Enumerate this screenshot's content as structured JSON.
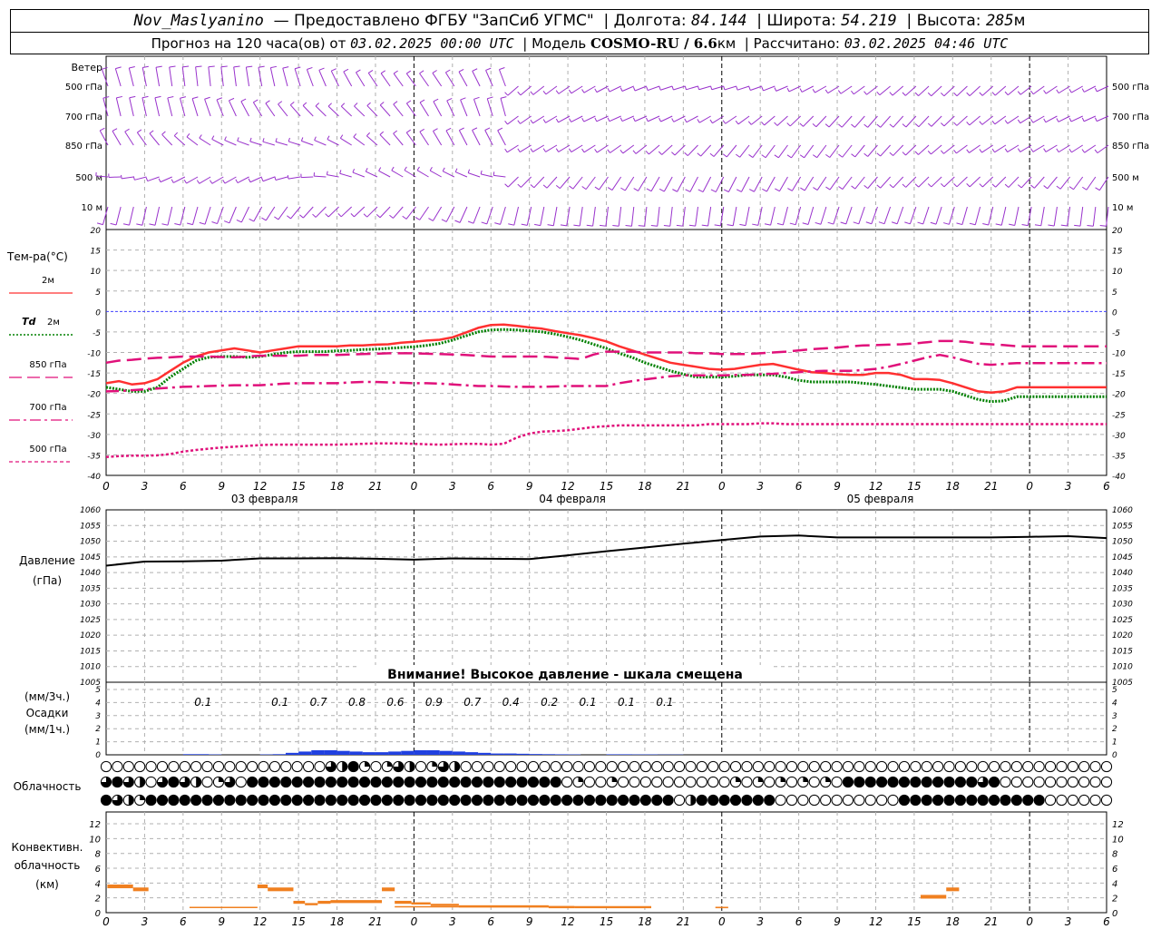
{
  "header": {
    "station": "Nov_Maslyanino",
    "provider": "Предоставлено ФГБУ \"ЗапСиб УГМС\"",
    "lon_label": "Долгота:",
    "lon": "84.144",
    "lat_label": "Широта:",
    "lat": "54.219",
    "alt_label": "Высота:",
    "alt": "285",
    "alt_unit": "м",
    "forecast_label": "Прогноз на 120 часа(ов) от",
    "forecast_start": "03.02.2025 00:00 UTC",
    "model_label": "Модель",
    "model": "COSMO-RU / 6.6",
    "model_unit": "км",
    "computed_label": "Рассчитано:",
    "computed": "03.02.2025 04:46 UTC"
  },
  "hour_ticks": [
    "0",
    "3",
    "6",
    "9",
    "12",
    "15",
    "18",
    "21",
    "0",
    "3",
    "6",
    "9",
    "12",
    "15",
    "18",
    "21",
    "0",
    "3",
    "6",
    "9",
    "12",
    "15",
    "18",
    "21",
    "0",
    "3",
    "6"
  ],
  "dates": [
    "03 февраля",
    "04 февраля",
    "05 февраля"
  ],
  "wind": {
    "title": "Ветер",
    "levels": [
      "500 гПа",
      "700 гПа",
      "850 гПа",
      "500 м",
      "10 м"
    ],
    "color": "#9932cc"
  },
  "temp": {
    "title": "Тем-ра(°C)",
    "ylim": [
      -40,
      20
    ],
    "ticks": [
      "20",
      "15",
      "10",
      "5",
      "0",
      "-5",
      "-10",
      "-15",
      "-20",
      "-25",
      "-30",
      "-35",
      "-40"
    ],
    "legend": [
      {
        "label": "2м",
        "color": "#ff3030",
        "dash": "solid"
      },
      {
        "label_pre": "Td",
        "label": "2м",
        "color": "#008000",
        "dash": "dotted"
      },
      {
        "label": "850 гПа",
        "color": "#e0107a",
        "dash": "long"
      },
      {
        "label": "700 гПа",
        "color": "#e0107a",
        "dash": "dashdot"
      },
      {
        "label": "500 гПа",
        "color": "#e0107a",
        "dash": "short"
      }
    ]
  },
  "pressure": {
    "title": "Давление",
    "unit": "(гПа)",
    "ylim": [
      1005,
      1060
    ],
    "ticks": [
      "1060",
      "1055",
      "1050",
      "1045",
      "1040",
      "1035",
      "1030",
      "1025",
      "1020",
      "1015",
      "1010",
      "1005"
    ],
    "warning": "Внимание! Высокое давление - шкала смещена"
  },
  "precip": {
    "unit3": "(мм/3ч.)",
    "title": "Осадки",
    "unit1": "(мм/1ч.)",
    "ticks": [
      "5",
      "4",
      "3",
      "2",
      "1",
      "0"
    ],
    "labels3h": [
      {
        "h": 6,
        "v": "0.1"
      },
      {
        "h": 12,
        "v": "0.1"
      },
      {
        "h": 15,
        "v": "0.7"
      },
      {
        "h": 18,
        "v": "0.8"
      },
      {
        "h": 21,
        "v": "0.6"
      },
      {
        "h": 24,
        "v": "0.9"
      },
      {
        "h": 27,
        "v": "0.7"
      },
      {
        "h": 30,
        "v": "0.4"
      },
      {
        "h": 33,
        "v": "0.2"
      },
      {
        "h": 36,
        "v": "0.1"
      },
      {
        "h": 39,
        "v": "0.1"
      },
      {
        "h": 42,
        "v": "0.1"
      }
    ]
  },
  "cloud": {
    "title": "Облачность"
  },
  "conv": {
    "title1": "Конвективн.",
    "title2": "облачность",
    "unit": "(км)",
    "ticks": [
      "12",
      "10",
      "8",
      "6",
      "4",
      "2",
      "0"
    ]
  },
  "colors": {
    "t2m": "#ff3030",
    "td": "#008000",
    "upper": "#e0107a",
    "zero": "#4040ff",
    "pressure": "#000000",
    "precip": "#2040e0",
    "conv": "#f08020",
    "grid": "#b0b0b0"
  },
  "chart_data": [
    {
      "type": "line",
      "title": "Тем-ра(°C)",
      "ylim": [
        -40,
        20
      ],
      "x": [
        0,
        1,
        2,
        3,
        4,
        5,
        6,
        7,
        8,
        9,
        10,
        11,
        12,
        13,
        14,
        15,
        16,
        17,
        18,
        19,
        20,
        21,
        22,
        23,
        24,
        25,
        26,
        27,
        28,
        29,
        30,
        31,
        32,
        33,
        34,
        35,
        36,
        37,
        38,
        39,
        40,
        41,
        42,
        43,
        44,
        45,
        46,
        47,
        48,
        49,
        50,
        51,
        52,
        53,
        54,
        55,
        56,
        57,
        58,
        59,
        60,
        61,
        62,
        63,
        64,
        65,
        66,
        67,
        68,
        69,
        70,
        71,
        72,
        73,
        74,
        75,
        76,
        77,
        78
      ],
      "series": [
        {
          "name": "2м",
          "values": [
            -17.5,
            -17,
            -17.8,
            -17.5,
            -16.5,
            -14.5,
            -12.5,
            -11,
            -10,
            -9.5,
            -9,
            -9.5,
            -10,
            -9.5,
            -9,
            -8.5,
            -8.5,
            -8.5,
            -8.5,
            -8.3,
            -8.3,
            -8.1,
            -8,
            -7.6,
            -7.4,
            -7.1,
            -6.9,
            -6.3,
            -5.2,
            -4,
            -3.3,
            -3.2,
            -3.5,
            -3.9,
            -4.2,
            -4.8,
            -5.3,
            -5.8,
            -6.5,
            -7.3,
            -8.5,
            -9.5,
            -10.5,
            -11.5,
            -12.5,
            -13,
            -13.5,
            -14,
            -14.2,
            -14,
            -13.5,
            -13,
            -12.8,
            -13.5,
            -14.2,
            -14.8,
            -15,
            -15.3,
            -15.5,
            -15.5,
            -15,
            -15,
            -15.5,
            -16.5,
            -16.5,
            -16.7,
            -17.5,
            -18.5,
            -19.5,
            -19.8,
            -19.5,
            -18.5,
            -18.5,
            -18.5,
            -18.5,
            -18.5,
            -18.5,
            -18.5,
            -18.5
          ]
        },
        {
          "name": "Td 2м",
          "values": [
            -18.5,
            -19,
            -19.5,
            -19.5,
            -18.5,
            -16,
            -14,
            -12,
            -11.2,
            -11,
            -11,
            -11.2,
            -11,
            -10.5,
            -10,
            -9.8,
            -9.8,
            -9.8,
            -9.6,
            -9.5,
            -9.3,
            -9.2,
            -9,
            -8.8,
            -8.6,
            -8.3,
            -7.8,
            -7,
            -6,
            -5,
            -4.5,
            -4.4,
            -4.5,
            -4.7,
            -5,
            -5.5,
            -6.2,
            -7,
            -8,
            -9,
            -10.2,
            -11.2,
            -12.5,
            -13.5,
            -14.5,
            -15.3,
            -16,
            -16,
            -16,
            -15.8,
            -15.5,
            -15.5,
            -15.5,
            -16,
            -16.8,
            -17.2,
            -17.2,
            -17.2,
            -17.2,
            -17.5,
            -17.8,
            -18.2,
            -18.6,
            -19,
            -19,
            -19,
            -19.5,
            -20.5,
            -21.5,
            -22,
            -21.8,
            -20.8,
            -20.8,
            -20.8,
            -20.8,
            -20.8,
            -20.8,
            -20.8,
            -20.8
          ]
        },
        {
          "name": "850 гПа",
          "values": [
            -12.5,
            -12,
            -11.8,
            -11.5,
            -11.3,
            -11.2,
            -11,
            -11,
            -11,
            -11.1,
            -11.2,
            -11,
            -10.8,
            -10.8,
            -10.8,
            -10.8,
            -10.6,
            -10.6,
            -10.6,
            -10.5,
            -10.4,
            -10.3,
            -10.2,
            -10.2,
            -10.2,
            -10.3,
            -10.4,
            -10.5,
            -10.6,
            -10.8,
            -11,
            -11,
            -11,
            -11,
            -11,
            -11.2,
            -11.4,
            -11.6,
            -10.5,
            -9.8,
            -9.8,
            -9.8,
            -10,
            -10,
            -10,
            -10,
            -10.2,
            -10.2,
            -10.4,
            -10.4,
            -10.4,
            -10.2,
            -10,
            -9.8,
            -9.5,
            -9.2,
            -9,
            -8.8,
            -8.5,
            -8.3,
            -8.2,
            -8.1,
            -8,
            -7.8,
            -7.5,
            -7.2,
            -7.2,
            -7.4,
            -7.8,
            -8,
            -8.2,
            -8.5,
            -8.5,
            -8.5,
            -8.5,
            -8.5,
            -8.5,
            -8.5,
            -8.5
          ]
        },
        {
          "name": "700 гПа",
          "values": [
            -19.5,
            -19.4,
            -19.2,
            -19,
            -18.8,
            -18.6,
            -18.4,
            -18.3,
            -18.2,
            -18.1,
            -18,
            -18,
            -18,
            -17.8,
            -17.6,
            -17.5,
            -17.5,
            -17.5,
            -17.5,
            -17.3,
            -17.2,
            -17.2,
            -17.3,
            -17.4,
            -17.5,
            -17.5,
            -17.6,
            -17.8,
            -18,
            -18.2,
            -18.2,
            -18.3,
            -18.4,
            -18.4,
            -18.4,
            -18.3,
            -18.2,
            -18.2,
            -18.2,
            -18.2,
            -17.5,
            -17,
            -16.6,
            -16.2,
            -15.8,
            -15.6,
            -15.6,
            -15.6,
            -15.6,
            -15.5,
            -15.5,
            -15.3,
            -15.2,
            -15,
            -14.8,
            -14.6,
            -14.5,
            -14.5,
            -14.5,
            -14.3,
            -14,
            -13.5,
            -12.8,
            -12,
            -11.2,
            -10.6,
            -11.2,
            -12,
            -12.8,
            -13,
            -12.8,
            -12.6,
            -12.6,
            -12.6,
            -12.6,
            -12.6,
            -12.6,
            -12.6,
            -12.6
          ]
        },
        {
          "name": "500 гПа",
          "values": [
            -35.5,
            -35.3,
            -35.2,
            -35.2,
            -35.1,
            -34.8,
            -34.2,
            -33.8,
            -33.5,
            -33.2,
            -33,
            -32.8,
            -32.6,
            -32.5,
            -32.5,
            -32.5,
            -32.5,
            -32.5,
            -32.5,
            -32.4,
            -32.3,
            -32.2,
            -32.2,
            -32.2,
            -32.3,
            -32.4,
            -32.5,
            -32.4,
            -32.3,
            -32.3,
            -32.5,
            -32.3,
            -30.8,
            -29.8,
            -29.3,
            -29.2,
            -29,
            -28.6,
            -28.2,
            -28,
            -27.8,
            -27.8,
            -27.8,
            -27.8,
            -27.8,
            -27.8,
            -27.8,
            -27.5,
            -27.5,
            -27.5,
            -27.5,
            -27.3,
            -27.3,
            -27.5,
            -27.5,
            -27.5,
            -27.5,
            -27.5,
            -27.5,
            -27.5,
            -27.5,
            -27.5,
            -27.5,
            -27.5,
            -27.5,
            -27.5,
            -27.5,
            -27.5,
            -27.5,
            -27.5,
            -27.5,
            -27.5,
            -27.5,
            -27.5,
            -27.5,
            -27.5,
            -27.5,
            -27.5,
            -27.5
          ]
        }
      ]
    },
    {
      "type": "line",
      "title": "Давление",
      "ylim": [
        1005,
        1060
      ],
      "x": [
        0,
        3,
        6,
        9,
        12,
        15,
        18,
        21,
        24,
        27,
        30,
        33,
        36,
        39,
        42,
        45,
        48,
        51,
        54,
        57,
        60,
        63,
        66,
        69,
        72,
        75,
        78
      ],
      "series": [
        {
          "name": "Давление",
          "values": [
            1042.2,
            1043.5,
            1043.6,
            1043.8,
            1044.5,
            1044.5,
            1044.6,
            1044.4,
            1044.1,
            1044.5,
            1044.4,
            1044.3,
            1045.5,
            1046.8,
            1048,
            1049.2,
            1050.4,
            1051.5,
            1051.8,
            1051.2,
            1051.2,
            1051.2,
            1051.2,
            1051.2,
            1051.4,
            1051.6,
            1051
          ]
        }
      ]
    },
    {
      "type": "bar",
      "title": "Осадки",
      "ylim": [
        0,
        5
      ],
      "x": [
        6,
        7,
        8,
        12,
        13,
        14,
        15,
        16,
        17,
        18,
        19,
        20,
        21,
        22,
        23,
        24,
        25,
        26,
        27,
        28,
        29,
        30,
        31,
        32,
        33,
        34,
        35,
        36,
        39,
        40,
        41,
        42,
        43,
        44
      ],
      "values": [
        0.05,
        0.05,
        0.03,
        0.03,
        0.05,
        0.15,
        0.25,
        0.35,
        0.35,
        0.3,
        0.25,
        0.2,
        0.2,
        0.25,
        0.3,
        0.35,
        0.35,
        0.3,
        0.25,
        0.2,
        0.15,
        0.1,
        0.1,
        0.08,
        0.06,
        0.05,
        0.04,
        0.03,
        0.04,
        0.04,
        0.03,
        0.03,
        0.02,
        0.02
      ]
    },
    {
      "type": "bar",
      "title": "Конвективн. облачность",
      "ylim": [
        0,
        13
      ],
      "segments": [
        {
          "h0": 0.1,
          "h1": 2.1,
          "top": 3.8,
          "base": 3.3
        },
        {
          "h0": 2.1,
          "h1": 3.3,
          "top": 3.4,
          "base": 2.9
        },
        {
          "h0": 11.8,
          "h1": 12.6,
          "top": 3.8,
          "base": 3.3
        },
        {
          "h0": 12.6,
          "h1": 14.6,
          "top": 3.4,
          "base": 2.9
        },
        {
          "h0": 14.6,
          "h1": 15.5,
          "top": 1.6,
          "base": 1.2
        },
        {
          "h0": 15.5,
          "h1": 16.5,
          "top": 1.3,
          "base": 1.0
        },
        {
          "h0": 16.5,
          "h1": 17.5,
          "top": 1.6,
          "base": 1.2
        },
        {
          "h0": 17.5,
          "h1": 21.5,
          "top": 1.7,
          "base": 1.3
        },
        {
          "h0": 21.5,
          "h1": 22.5,
          "top": 3.4,
          "base": 2.9
        },
        {
          "h0": 22.5,
          "h1": 23.8,
          "top": 1.6,
          "base": 1.2
        },
        {
          "h0": 23.8,
          "h1": 25.3,
          "top": 1.4,
          "base": 1.1
        },
        {
          "h0": 25.3,
          "h1": 27.5,
          "top": 1.2,
          "base": 0.9
        },
        {
          "h0": 27.5,
          "h1": 34.5,
          "top": 1.0,
          "base": 0.7
        },
        {
          "h0": 34.5,
          "h1": 36.5,
          "top": 0.9,
          "base": 0.6
        },
        {
          "h0": 36.5,
          "h1": 42.5,
          "top": 0.8,
          "base": 0.6
        },
        {
          "h0": 47.5,
          "h1": 48.5,
          "top": 0.8,
          "base": 0.6
        },
        {
          "h0": 63.5,
          "h1": 65.5,
          "top": 2.4,
          "base": 1.9
        },
        {
          "h0": 65.5,
          "h1": 66.5,
          "top": 3.4,
          "base": 2.9
        }
      ],
      "thin": [
        {
          "h0": 6.5,
          "h1": 11.8,
          "v": 0.7
        },
        {
          "h0": 22.5,
          "h1": 42.5,
          "v": 0.8
        }
      ]
    }
  ]
}
